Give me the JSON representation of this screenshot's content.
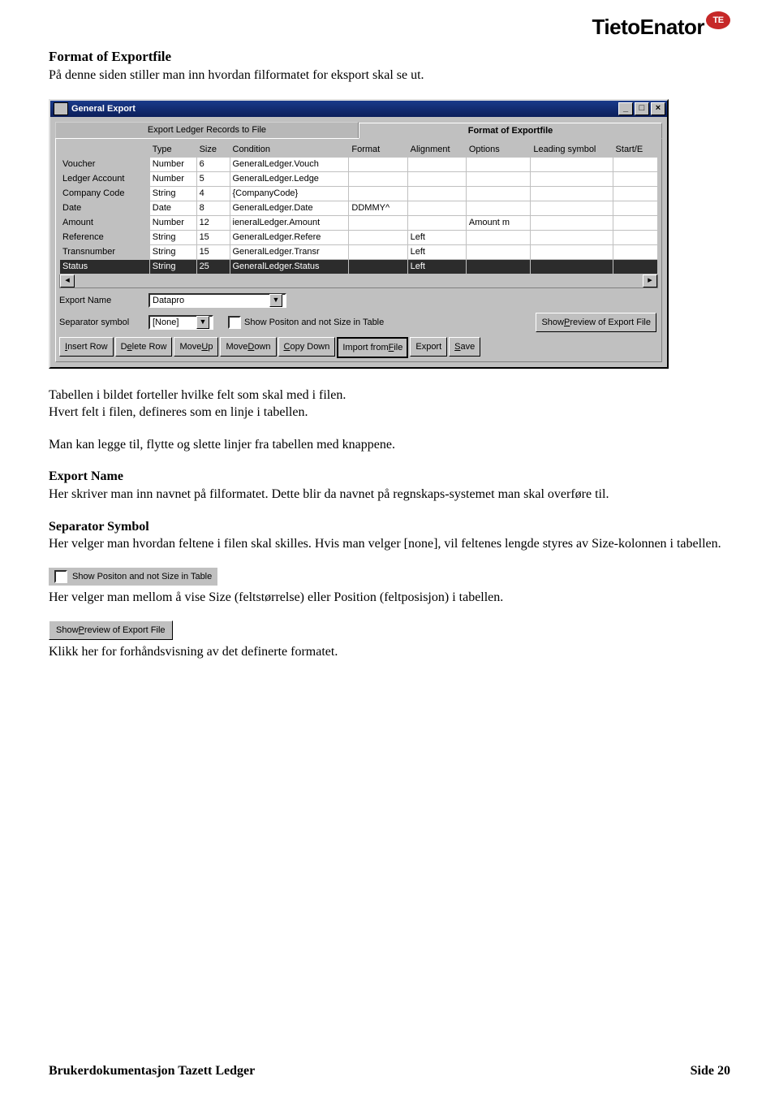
{
  "logo": {
    "brand": "TietoEnator",
    "badge": "TE"
  },
  "doc": {
    "heading1": "Format of Exportfile",
    "intro": "På denne siden stiller man inn hvordan filformatet for eksport skal se ut.",
    "after_img_1": "Tabellen i bildet forteller hvilke felt som skal med i filen.",
    "after_img_2": "Hvert felt i filen, defineres som en linje i tabellen.",
    "after_img_3": "Man kan legge til, flytte og slette linjer fra tabellen med knappene.",
    "exportname_h": "Export Name",
    "exportname_p": "Her skriver man inn navnet på filformatet. Dette blir da navnet på regnskaps-systemet man skal overføre til.",
    "sep_h": "Separator Symbol",
    "sep_p": "Her velger man hvordan feltene i filen skal skilles. Hvis man velger [none], vil feltenes lengde styres av Size-kolonnen i tabellen.",
    "showpos_p": "Her velger man mellom å vise Size (feltstørrelse) eller Position (feltposisjon) i tabellen.",
    "preview_p": "Klikk her for forhåndsvisning av det definerte formatet."
  },
  "win": {
    "title": "General Export",
    "tabs": {
      "left": "Export Ledger Records to File",
      "right": "Format of Exportfile"
    },
    "cols": [
      "",
      "Type",
      "Size",
      "Condition",
      "Format",
      "Alignment",
      "Options",
      "Leading symbol",
      "Start/E"
    ],
    "rows": [
      {
        "name": "Voucher",
        "type": "Number",
        "size": "6",
        "cond": "GeneralLedger.Vouch",
        "fmt": "",
        "align": "",
        "opt": "",
        "lead": "",
        "se": ""
      },
      {
        "name": "Ledger Account",
        "type": "Number",
        "size": "5",
        "cond": "GeneralLedger.Ledge",
        "fmt": "",
        "align": "",
        "opt": "",
        "lead": "",
        "se": ""
      },
      {
        "name": "Company Code",
        "type": "String",
        "size": "4",
        "cond": "{CompanyCode}",
        "fmt": "",
        "align": "",
        "opt": "",
        "lead": "",
        "se": ""
      },
      {
        "name": "Date",
        "type": "Date",
        "size": "8",
        "cond": "GeneralLedger.Date",
        "fmt": "DDMMY^",
        "align": "",
        "opt": "",
        "lead": "",
        "se": ""
      },
      {
        "name": "Amount",
        "type": "Number",
        "size": "12",
        "cond": "ieneralLedger.Amount",
        "fmt": "",
        "align": "",
        "opt": "Amount m",
        "lead": "",
        "se": ""
      },
      {
        "name": "Reference",
        "type": "String",
        "size": "15",
        "cond": "GeneralLedger.Refere",
        "fmt": "",
        "align": "Left",
        "opt": "",
        "lead": "",
        "se": ""
      },
      {
        "name": "Transnumber",
        "type": "String",
        "size": "15",
        "cond": "GeneralLedger.Transr",
        "fmt": "",
        "align": "Left",
        "opt": "",
        "lead": "",
        "se": ""
      },
      {
        "name": "Status",
        "type": "String",
        "size": "25",
        "cond": "GeneralLedger.Status",
        "fmt": "",
        "align": "Left",
        "opt": "",
        "lead": "",
        "se": ""
      }
    ],
    "exportname_label": "Export Name",
    "exportname_value": "Datapro",
    "separator_label": "Separator symbol",
    "separator_value": "[None]",
    "showpos_label": "Show Positon and not Size in Table",
    "previewbtn": "Show Preview of Export File",
    "buttons": {
      "insert": "Insert Row",
      "delete": "Delete Row",
      "moveup": "Move Up",
      "movedown": "Move Down",
      "copydown": "Copy Down",
      "import": "Import from File",
      "export": "Export",
      "save": "Save"
    }
  },
  "snippets": {
    "showpos": "Show Positon and not Size in Table",
    "preview": "Show Preview of Export File"
  },
  "footer": {
    "left": "Brukerdokumentasjon Tazett Ledger",
    "right": "Side 20"
  }
}
